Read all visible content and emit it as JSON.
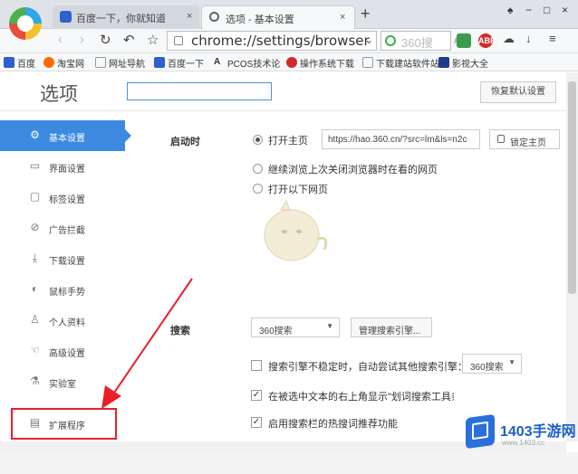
{
  "browser": {
    "tabs": [
      {
        "title": "百度一下，你就知道",
        "active": false
      },
      {
        "title": "选项 - 基本设置",
        "active": true
      }
    ],
    "address": "chrome://settings/browser",
    "search_placeholder": "360搜",
    "extensions": [
      "ABP"
    ],
    "bookmarks": [
      "百度",
      "淘宝网",
      "网址导航",
      "百度一下",
      "PCOS技术论",
      "操作系统下载",
      "下载建站软件站",
      "影视大全"
    ]
  },
  "settings": {
    "title": "选项",
    "reset_label": "恢复默认设置",
    "sidebar": [
      {
        "label": "基本设置",
        "icon": "gear-icon",
        "active": true
      },
      {
        "label": "界面设置",
        "icon": "window-icon"
      },
      {
        "label": "标签设置",
        "icon": "tab-icon"
      },
      {
        "label": "广告拦截",
        "icon": "block-icon"
      },
      {
        "label": "下载设置",
        "icon": "download-icon"
      },
      {
        "label": "鼠标手势",
        "icon": "mouse-icon"
      },
      {
        "label": "个人资料",
        "icon": "person-icon"
      },
      {
        "label": "高级设置",
        "icon": "hand-icon"
      },
      {
        "label": "实验室",
        "icon": "flask-icon"
      },
      {
        "label": "扩展程序",
        "icon": "extension-icon"
      }
    ],
    "startup": {
      "label": "启动时",
      "options": [
        "打开主页",
        "继续浏览上次关闭浏览器时在看的网页",
        "打开以下网页"
      ],
      "selected": 0,
      "homepage_url": "https://hao.360.cn/?src=lm&ls=n2c",
      "lock_label": "锁定主页"
    },
    "search": {
      "label": "搜索",
      "engine": "360搜索",
      "manage_label": "管理搜索引擎...",
      "fallback_label": "搜索引擎不稳定时，自动尝试其他搜索引擎：",
      "fallback_engine": "360搜索",
      "fallback_checked": false,
      "selection_label": "在被选中文本的右上角显示\"划词搜索工具条\"",
      "selection_checked": true,
      "hot_label": "启用搜索栏的热搜词推荐功能",
      "hot_checked": true
    }
  },
  "watermark": {
    "text": "1403手游网",
    "sub": "www.1403.cc"
  },
  "colors": {
    "accent": "#3b8ae0",
    "highlight": "#e8202a",
    "arrow": "#e8202a"
  }
}
